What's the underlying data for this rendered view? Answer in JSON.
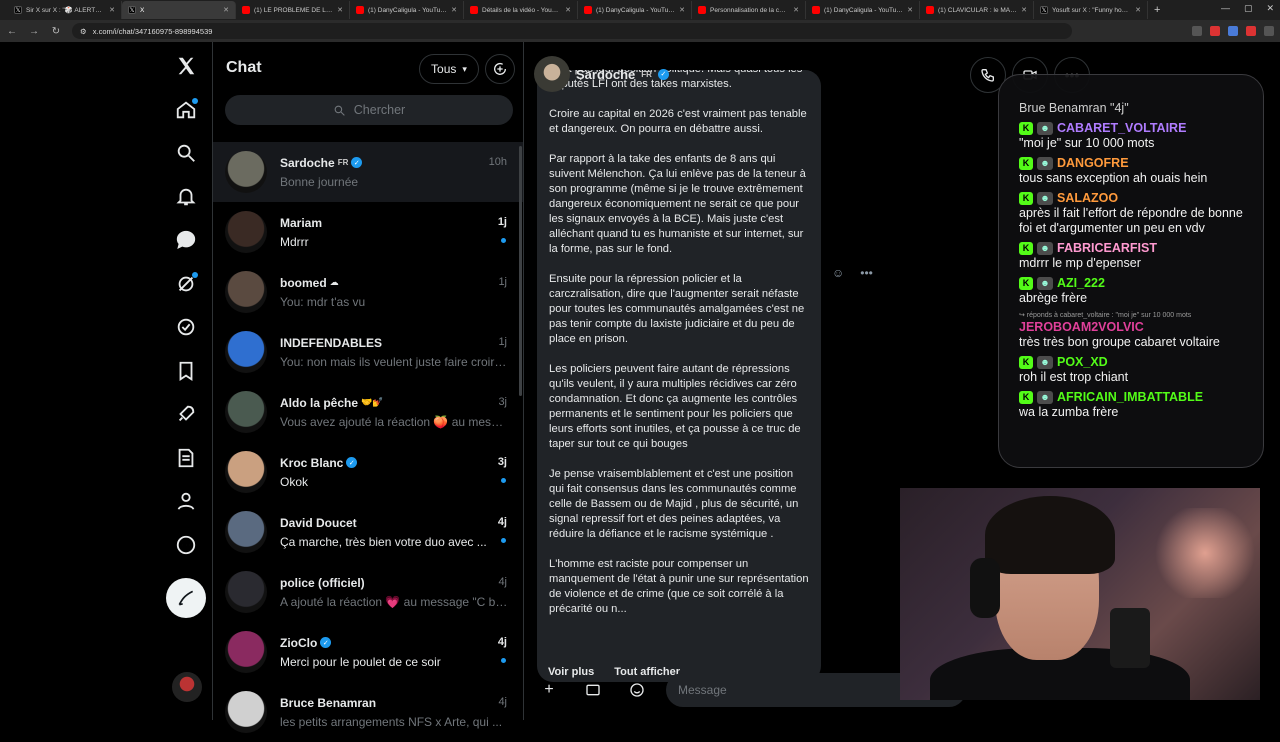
{
  "browser": {
    "tabs": [
      {
        "title": "Sir X sur X : \"🎲 ALERTE : Dan",
        "type": "x"
      },
      {
        "title": "X",
        "type": "x",
        "active": true
      },
      {
        "title": "(1) LE PROBLÈME DE LA VOIX",
        "type": "yt"
      },
      {
        "title": "(1) DanyCaligula - YouTube",
        "type": "yt"
      },
      {
        "title": "Détails de la vidéo - YouTube",
        "type": "yt"
      },
      {
        "title": "(1) DanyCaligula - YouTube",
        "type": "yt"
      },
      {
        "title": "Personnalisation de la chaîne",
        "type": "yt"
      },
      {
        "title": "(1) DanyCaligula - YouTube",
        "type": "yt"
      },
      {
        "title": "(1) CLAVICULAR : le MASCU",
        "type": "yt"
      },
      {
        "title": "Yosuft sur X : \"Funny how can",
        "type": "x"
      }
    ],
    "url": "x.com/i/chat/347160975-898994539"
  },
  "chat": {
    "title": "Chat",
    "filter_label": "Tous",
    "search_placeholder": "Chercher",
    "conversations": [
      {
        "name": "Sardoche",
        "flag": "FR",
        "verified": true,
        "preview": "Bonne journée",
        "time": "10h",
        "unread": false,
        "selected": true,
        "color": "#6b6b60"
      },
      {
        "name": "Mariam",
        "verified": false,
        "preview": "Mdrrr",
        "time": "1j",
        "unread": true,
        "color": "#3a2a24"
      },
      {
        "name": "boomed",
        "emoji": "☁",
        "verified": false,
        "preview": "You: mdr t'as vu",
        "time": "1j",
        "unread": false,
        "color": "#5a4a40"
      },
      {
        "name": "INDEFENDABLES",
        "verified": false,
        "preview": "You: non mais ils veulent juste faire croire ...",
        "time": "1j",
        "unread": false,
        "color": "#2f6fd0"
      },
      {
        "name": "Aldo la pêche",
        "emoji": "🤝💅",
        "verified": false,
        "preview": "Vous avez ajouté la réaction 🍑 au message ...",
        "time": "3j",
        "unread": false,
        "color": "#4a5a50"
      },
      {
        "name": "Kroc Blanc",
        "verified": true,
        "preview": "Okok",
        "time": "3j",
        "unread": true,
        "color": "#caa080"
      },
      {
        "name": "David Doucet",
        "verified": false,
        "preview": "Ça marche, très bien votre duo avec ...",
        "time": "4j",
        "unread": true,
        "color": "#5a6a80"
      },
      {
        "name": "police (officiel)",
        "verified": false,
        "preview": "A ajouté la réaction 💗 au message \"C bon\"",
        "time": "4j",
        "unread": false,
        "color": "#2a2a30"
      },
      {
        "name": "ZioClo",
        "verified": true,
        "preview": "Merci pour le poulet de ce soir",
        "time": "4j",
        "unread": true,
        "color": "#8a2a60"
      },
      {
        "name": "Bruce Benamran",
        "verified": false,
        "preview": "les petits arrangements NFS x Arte, qui ...",
        "time": "4j",
        "unread": false,
        "color": "#d0d0d0"
      }
    ]
  },
  "conversation": {
    "name": "Sardoche",
    "flag": "FR",
    "paragraphs": [
      "c'est pas leur position politique. Mais quasi tous les députés LFI ont des takes marxistes.",
      "Croire au capital en 2026 c'est vraiment pas tenable et dangereux. On pourra en débattre aussi.",
      "Par rapport à la take des enfants de 8 ans qui suivent Mélenchon. Ça lui enlève pas de la teneur à son programme (même si je le trouve extrêmement dangereux économiquement ne serait ce que pour les signaux envoyés à la BCE). Mais juste c'est alléchant quand tu es humaniste et sur internet, sur la forme, pas sur le fond.",
      "Ensuite pour la répression policier et la carczralisation, dire que l'augmenter serait néfaste pour toutes les communautés amalgamées c'est ne pas tenir compte du laxiste judiciaire et du peu de place en prison.",
      "Les policiers peuvent faire autant de répressions qu'ils veulent, il y aura multiples récidives car zéro condamnation. Et donc ça augmente les contrôles permanents et le sentiment pour les policiers que leurs efforts sont inutiles, et ça pousse à ce truc de taper sur tout ce qui bouges",
      "Je pense vraisemblablement et c'est une position qui fait consensus dans les communautés comme celle de Bassem ou de Majid , plus de sécurité, un signal repressif fort et des peines adaptées, va réduire la défiance et le racisme systémique .",
      "L'homme est raciste pour compenser un manquement de l'état à punir une sur représentation de violence et de crime (que ce soit corrélé à la précarité ou n..."
    ],
    "voir_plus": "Voir plus",
    "tout_afficher": "Tout afficher",
    "message_placeholder": "Message"
  },
  "stream_chat": {
    "top_line": "Brue Benamran \"4j\"",
    "messages": [
      {
        "user": "CABARET_VOLTAIRE",
        "color": "#b07cff",
        "text": "\"moi je\" sur 10 000 mots"
      },
      {
        "user": "DANGOFRE",
        "color": "#ff9a3c",
        "text": "tous sans exception ah ouais hein"
      },
      {
        "user": "SALAZOO",
        "color": "#ff9a3c",
        "text": "après il fait l'effort de répondre de bonne foi et d'argumenter un peu en vdv"
      },
      {
        "user": "FABRICEARFIST",
        "color": "#ff9ad0",
        "text": "mdrrr le mp d'epenser"
      },
      {
        "user": "AZI_222",
        "color": "#53fc18",
        "text": "abrège frère"
      },
      {
        "reply": "↪ réponds à cabaret_voltaire : \"moi je\" sur 10 000 mots",
        "user": "JEROBOAM2VOLVIC",
        "color": "#e0409a",
        "text": "très très bon groupe cabaret voltaire",
        "nobadge": true
      },
      {
        "user": "POX_XD",
        "color": "#53fc18",
        "text": "roh il est trop chiant"
      },
      {
        "user": "AFRICAIN_IMBATTABLE",
        "color": "#53fc18",
        "text": "wa la zumba frère"
      }
    ]
  }
}
